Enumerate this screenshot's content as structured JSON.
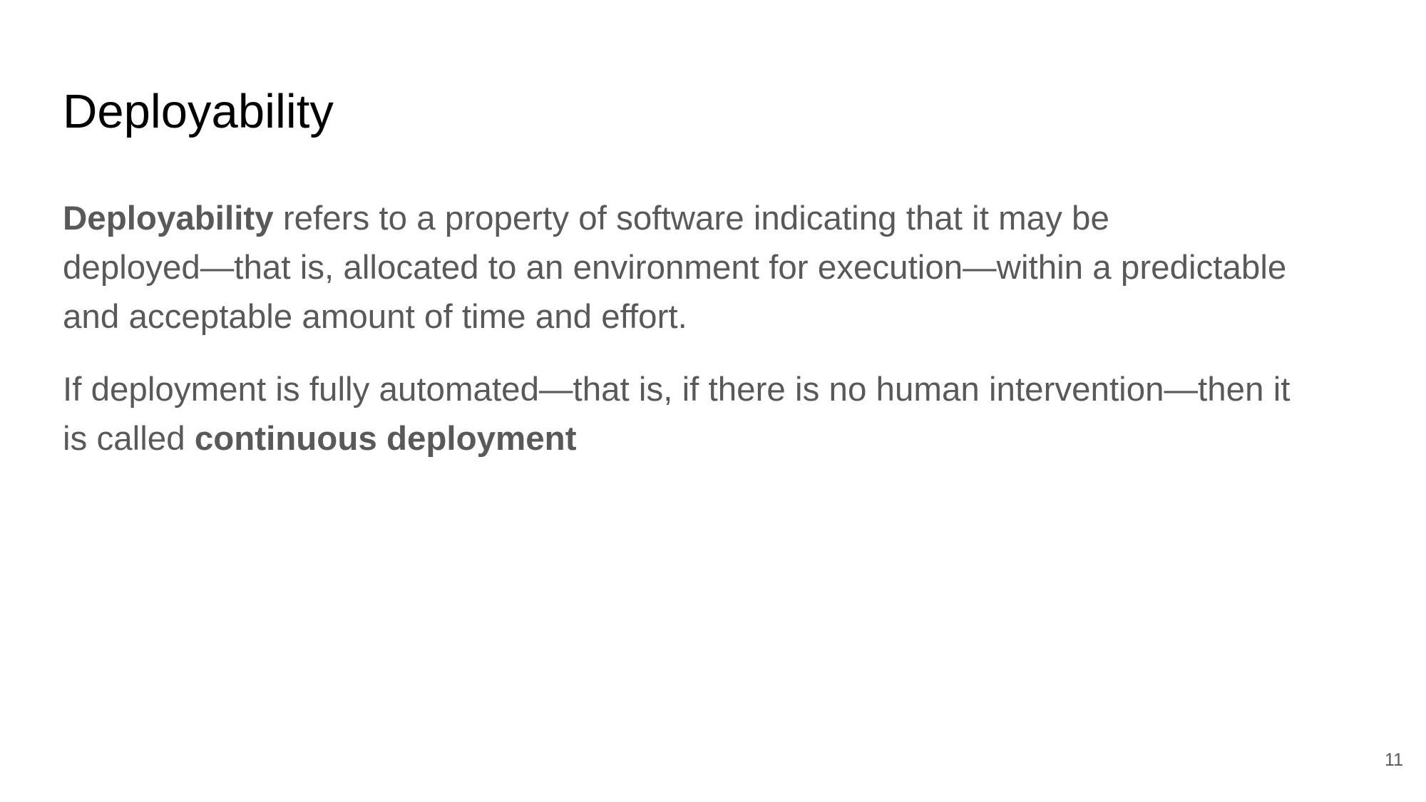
{
  "slide": {
    "title": "Deployability",
    "paragraphs": [
      {
        "lines": [
          {
            "bold": "Deployability",
            "text": " refers to a property of software indicating that it may be"
          },
          {
            "text": "deployed—that is, allocated to an environment for execution—within a predictable"
          },
          {
            "text": "and acceptable amount of time and effort."
          }
        ]
      },
      {
        "lines": [
          {
            "text": "If deployment is fully automated—that is, if there is no human intervention—then it"
          },
          {
            "text": "is called ",
            "bold": "continuous deployment"
          }
        ]
      }
    ],
    "page_number": "11"
  },
  "colors": {
    "title": "#000000",
    "body_text": "#595959",
    "background": "#ffffff"
  }
}
